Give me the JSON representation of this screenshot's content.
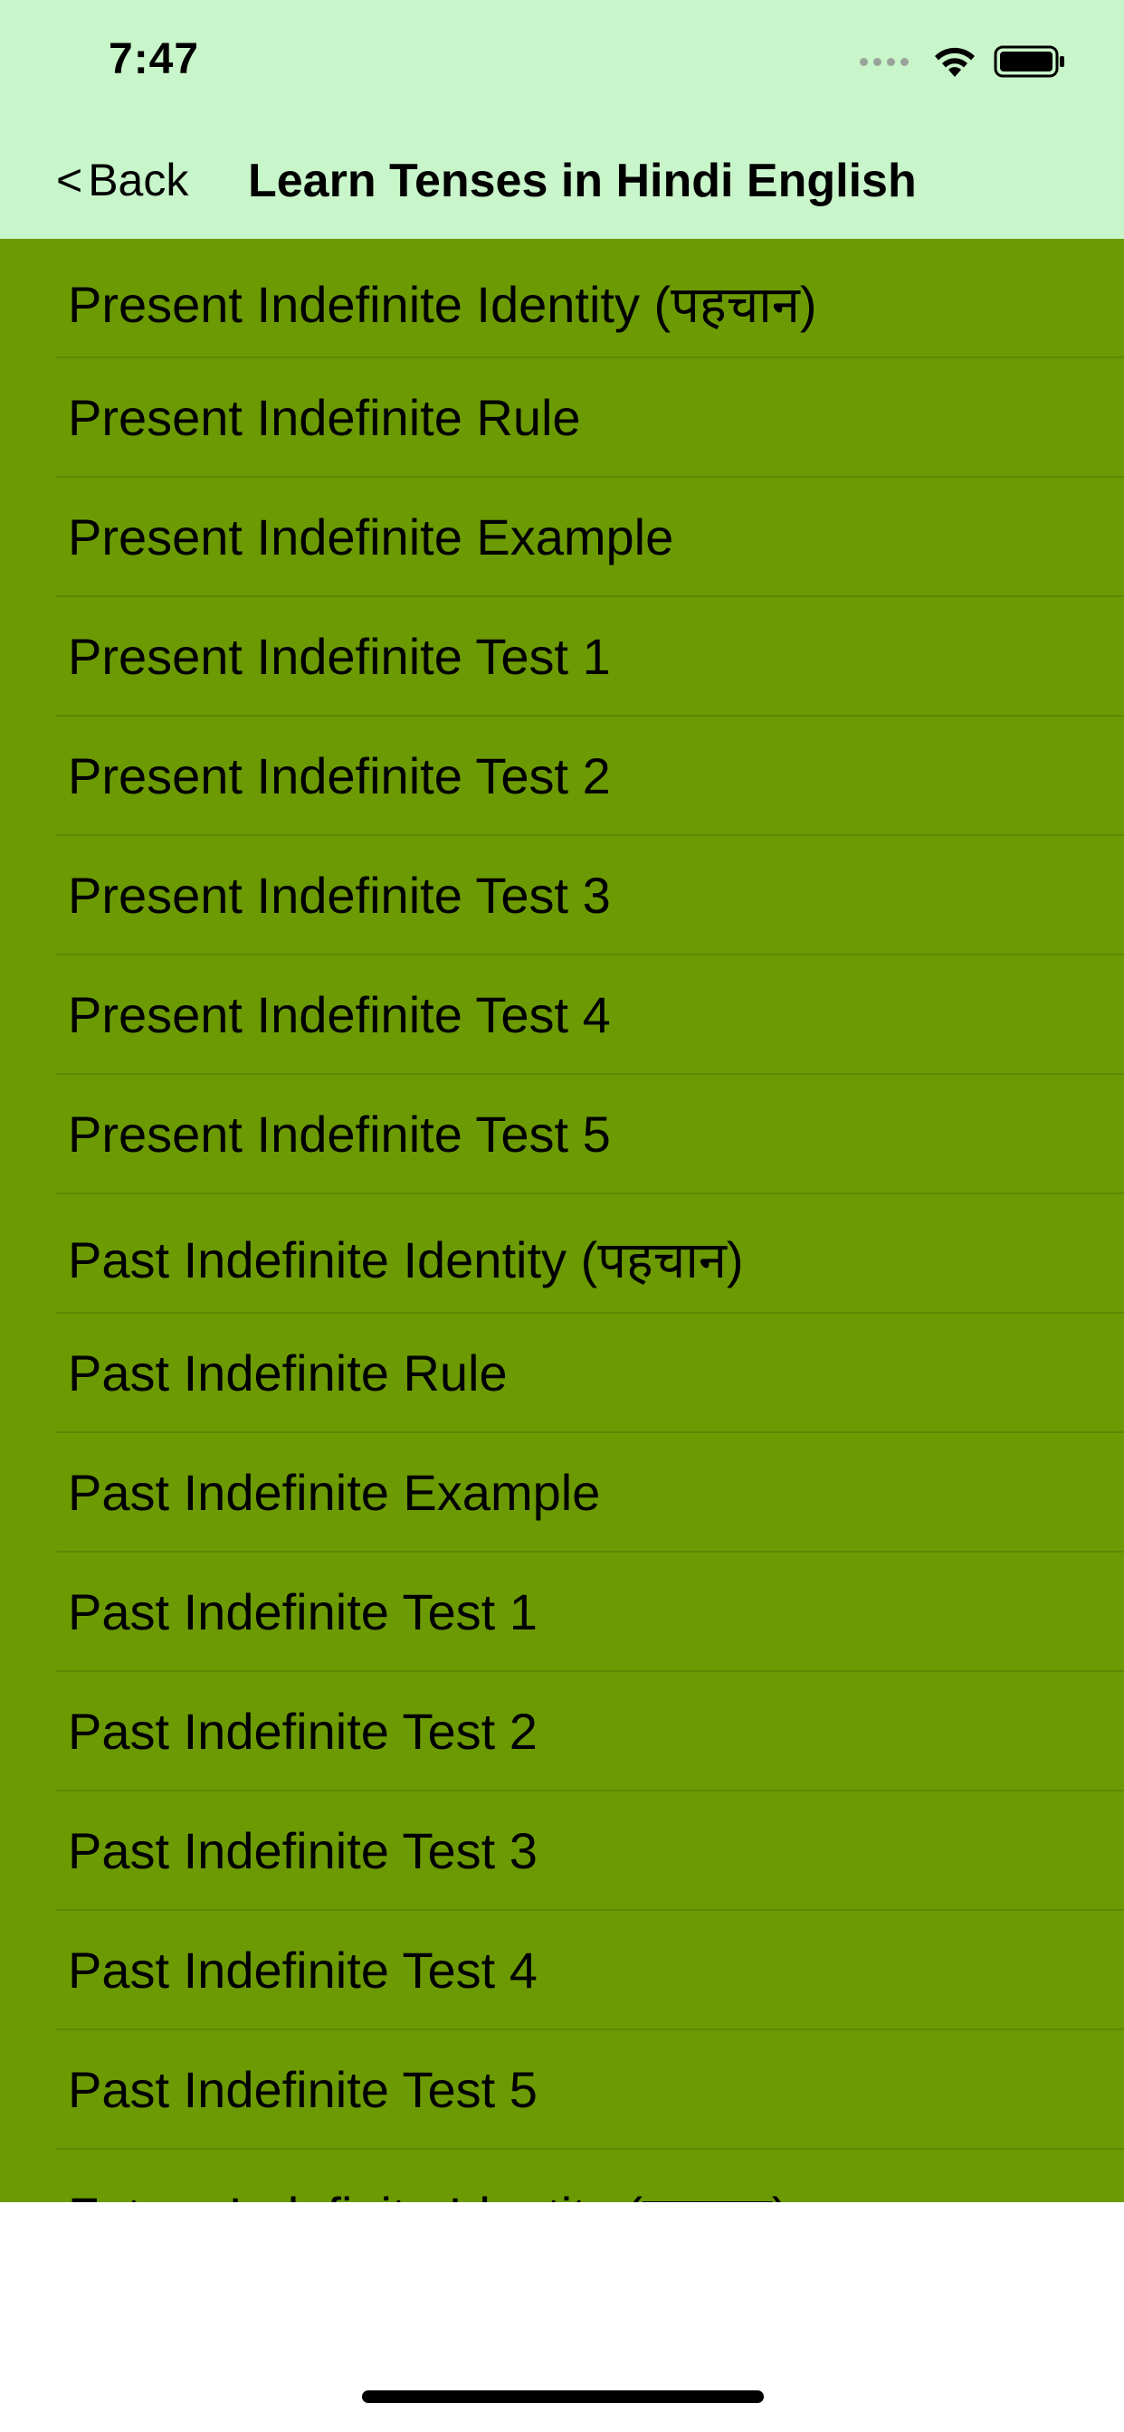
{
  "status_bar": {
    "time": "7:47",
    "icons": [
      "signal-dots-icon",
      "wifi-icon",
      "battery-icon"
    ]
  },
  "nav": {
    "back_label": "Back",
    "back_chevron": "<",
    "title": "Learn Tenses in Hindi English"
  },
  "colors": {
    "header_bg": "#c8f5c9",
    "list_bg": "#6c9a03",
    "divider": "#5e8703",
    "text": "#000000"
  },
  "list": {
    "items": [
      {
        "label": "Present Indefinite Identity (पहचान)"
      },
      {
        "label": "Present Indefinite Rule"
      },
      {
        "label": "Present Indefinite Example"
      },
      {
        "label": "Present Indefinite Test 1"
      },
      {
        "label": "Present Indefinite Test 2"
      },
      {
        "label": "Present Indefinite Test 3"
      },
      {
        "label": "Present Indefinite Test 4"
      },
      {
        "label": "Present Indefinite Test 5"
      },
      {
        "label": "Past Indefinite Identity (पहचान)"
      },
      {
        "label": "Past Indefinite Rule"
      },
      {
        "label": "Past Indefinite Example"
      },
      {
        "label": "Past Indefinite Test 1"
      },
      {
        "label": "Past Indefinite Test 2"
      },
      {
        "label": "Past Indefinite Test 3"
      },
      {
        "label": "Past Indefinite Test 4"
      },
      {
        "label": "Past Indefinite Test 5"
      },
      {
        "label": "Future Indefinite Identity (पहचान)"
      }
    ]
  }
}
